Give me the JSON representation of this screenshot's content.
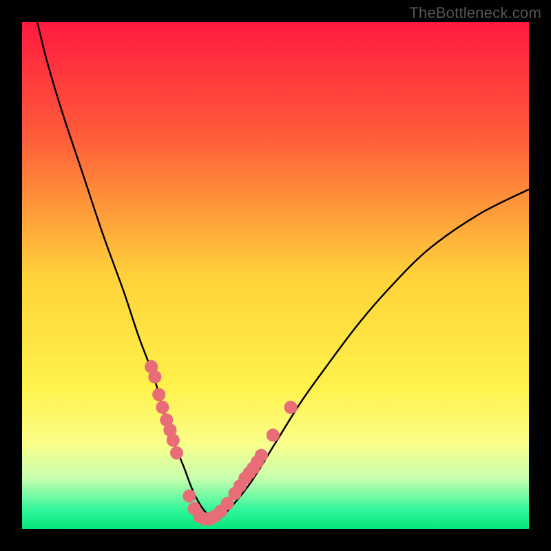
{
  "watermark": "TheBottleneck.com",
  "chart_data": {
    "type": "line",
    "title": "",
    "xlabel": "",
    "ylabel": "",
    "xlim": [
      0,
      100
    ],
    "ylim": [
      0,
      100
    ],
    "grid": false,
    "legend": false,
    "background": {
      "type": "vertical-gradient",
      "stops": [
        {
          "pos": 0.0,
          "color": "#ff1a3f"
        },
        {
          "pos": 0.22,
          "color": "#ff5a3a"
        },
        {
          "pos": 0.5,
          "color": "#ffd23a"
        },
        {
          "pos": 0.72,
          "color": "#fff24a"
        },
        {
          "pos": 0.83,
          "color": "#fbff8a"
        },
        {
          "pos": 0.9,
          "color": "#c7ffae"
        },
        {
          "pos": 0.965,
          "color": "#2cf59a"
        },
        {
          "pos": 1.0,
          "color": "#06e57c"
        }
      ]
    },
    "series": [
      {
        "name": "bottleneck-curve",
        "color": "#000000",
        "x": [
          3,
          5,
          8,
          12,
          16,
          20,
          23,
          26,
          28,
          30,
          32,
          33.5,
          35,
          36.5,
          38,
          40,
          45,
          50,
          55,
          60,
          66,
          72,
          80,
          90,
          100
        ],
        "y": [
          100,
          92,
          82,
          70,
          58,
          47,
          38,
          30,
          23,
          17,
          12,
          8,
          5,
          3,
          2,
          3,
          9,
          17,
          25,
          32,
          40,
          47,
          55,
          62,
          67
        ]
      }
    ],
    "markers": {
      "name": "sample-points",
      "color": "#e86d76",
      "radius_pct": 1.3,
      "points": [
        {
          "x": 25.5,
          "y": 32
        },
        {
          "x": 26.2,
          "y": 30
        },
        {
          "x": 27.0,
          "y": 26.5
        },
        {
          "x": 27.7,
          "y": 24
        },
        {
          "x": 28.5,
          "y": 21.5
        },
        {
          "x": 29.2,
          "y": 19.5
        },
        {
          "x": 29.8,
          "y": 17.5
        },
        {
          "x": 30.5,
          "y": 15
        },
        {
          "x": 33.0,
          "y": 6.5
        },
        {
          "x": 34.0,
          "y": 4.0
        },
        {
          "x": 35.0,
          "y": 2.5
        },
        {
          "x": 36.0,
          "y": 2.0
        },
        {
          "x": 37.0,
          "y": 2.0
        },
        {
          "x": 38.0,
          "y": 2.5
        },
        {
          "x": 39.2,
          "y": 3.5
        },
        {
          "x": 40.5,
          "y": 5.0
        },
        {
          "x": 42.0,
          "y": 7.0
        },
        {
          "x": 43.0,
          "y": 8.5
        },
        {
          "x": 44.0,
          "y": 10.0
        },
        {
          "x": 44.8,
          "y": 11.0
        },
        {
          "x": 45.6,
          "y": 12.0
        },
        {
          "x": 46.4,
          "y": 13.2
        },
        {
          "x": 47.2,
          "y": 14.5
        },
        {
          "x": 49.5,
          "y": 18.5
        },
        {
          "x": 53.0,
          "y": 24.0
        }
      ]
    }
  }
}
